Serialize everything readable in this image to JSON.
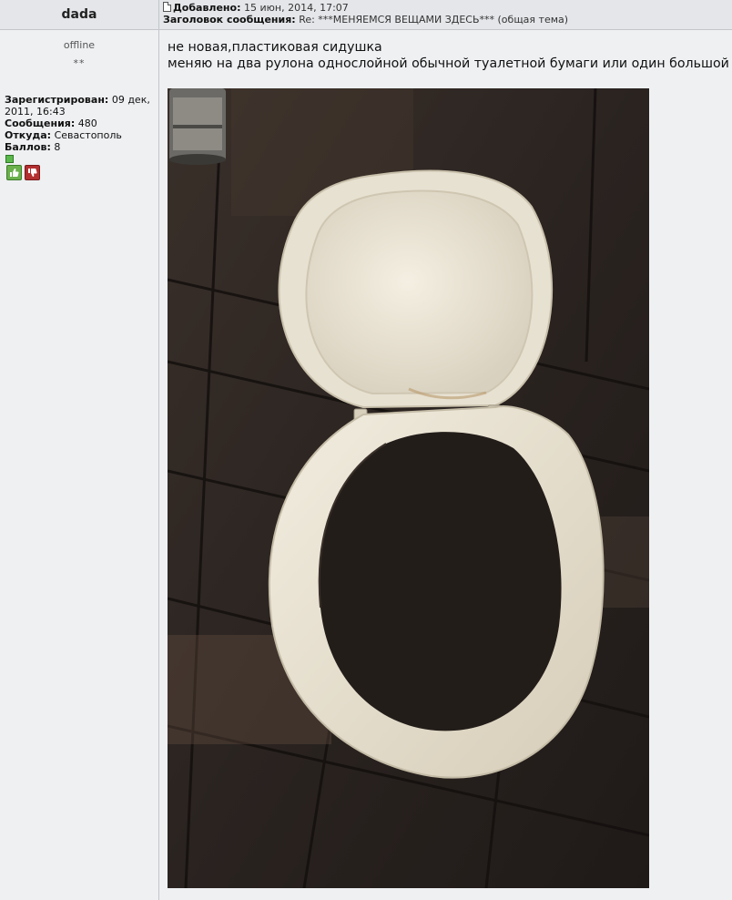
{
  "post": {
    "author": "dada",
    "meta": {
      "added_label": "Добавлено:",
      "added_value": "15 июн, 2014, 17:07",
      "subject_label": "Заголовок сообщения:",
      "subject_value": "Re: ***МЕНЯЕМСЯ ВЕЩАМИ ЗДЕСЬ*** (общая тема)"
    },
    "profile": {
      "status": "offline",
      "rank": "**",
      "registered_label": "Зарегистрирован:",
      "registered_value": "09 дек, 2011, 16:43",
      "posts_label": "Сообщения:",
      "posts_value": "480",
      "from_label": "Откуда:",
      "from_value": "Севастополь",
      "points_label": "Баллов:",
      "points_value": "8",
      "rep_up_icon": "thumbs-up-icon",
      "rep_down_icon": "thumbs-down-icon"
    },
    "message_lines": [
      "не новая,пластиковая сидушка",
      "меняю на два рулона однослойной обычной туалетной бумаги или один большой"
    ],
    "image": {
      "subject": "white plastic toilet seat with lid on wooden floor"
    },
    "colors": {
      "header_bg": "#e4e6e9",
      "body_bg": "#eef0f2",
      "rep_up": "#6ab04c",
      "rep_down": "#b23030"
    }
  }
}
